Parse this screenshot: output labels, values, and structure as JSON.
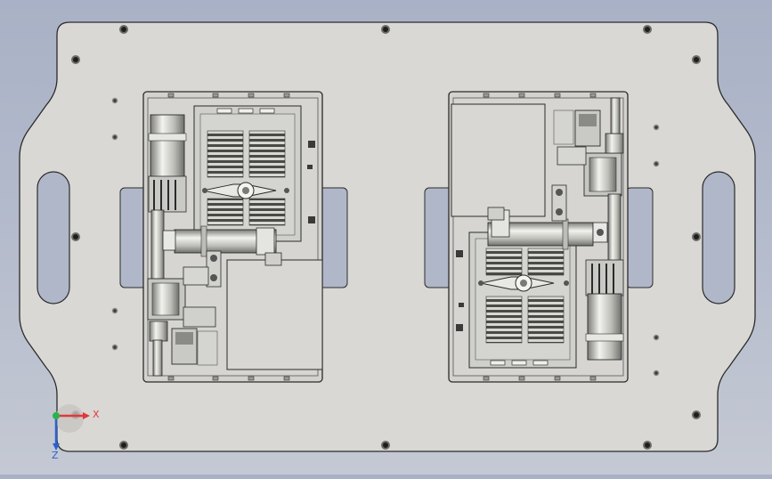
{
  "viewport": {
    "background_top": "#a9b1c6",
    "background_bottom": "#c4c9d3",
    "part_fill": "#d9d8d4",
    "part_stroke": "#2b2b2b",
    "component_fill": "#cfcfcb",
    "highlight": "#f4f4f0",
    "shadow": "#8d8d88"
  },
  "triad": {
    "x_label": "X",
    "z_label": "Z",
    "x_color": "#e0393b",
    "y_color": "#2bb24c",
    "z_color": "#2e5fd0"
  }
}
